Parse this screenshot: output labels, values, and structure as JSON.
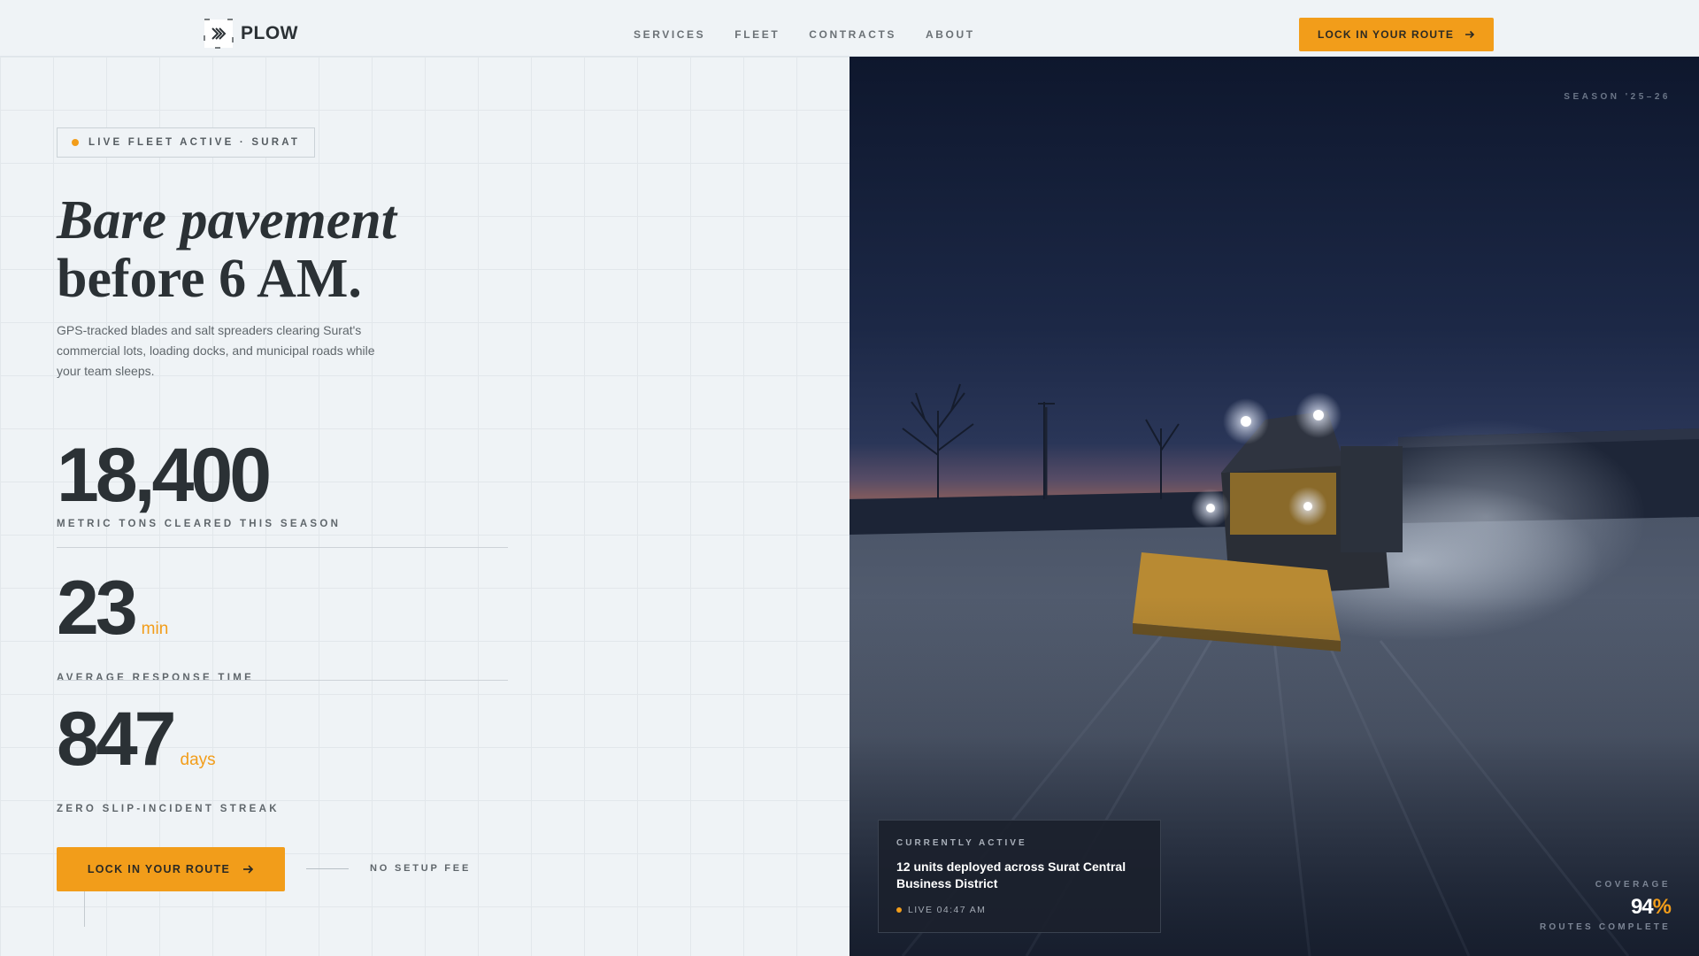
{
  "brand": {
    "name": "PLOW",
    "logo_icon": "chevron-logo-icon"
  },
  "nav": {
    "items": [
      {
        "label": "SERVICES"
      },
      {
        "label": "FLEET"
      },
      {
        "label": "CONTRACTS"
      },
      {
        "label": "ABOUT"
      }
    ],
    "cta_label": "LOCK IN YOUR ROUTE"
  },
  "hero": {
    "badge": "LIVE FLEET ACTIVE · SURAT",
    "headline_line1": "Bare pavement",
    "headline_line2": "before 6 AM.",
    "subcopy": "GPS-tracked blades and salt spreaders clearing Surat's commercial lots, loading docks, and municipal roads while your team sleeps."
  },
  "stats": [
    {
      "value": "18,400",
      "unit": "",
      "label": "METRIC TONS CLEARED THIS SEASON"
    },
    {
      "value": "23",
      "unit": "min",
      "label": "AVERAGE RESPONSE TIME"
    },
    {
      "value": "847",
      "unit": "days",
      "label": "ZERO SLIP-INCIDENT STREAK"
    }
  ],
  "cta": {
    "label": "LOCK IN YOUR ROUTE",
    "note": "NO SETUP FEE"
  },
  "image_panel": {
    "season": "SEASON '25–26",
    "active_card": {
      "kicker": "CURRENTLY ACTIVE",
      "title": "12 units deployed across Surat Central Business District",
      "status": "LIVE 04:47 AM"
    },
    "coverage": {
      "kicker": "COVERAGE",
      "value": "94",
      "percent_sign": "%",
      "sub": "ROUTES COMPLETE"
    }
  },
  "colors": {
    "accent": "#f29d1a",
    "ink": "#2b3135",
    "background": "#eff3f6",
    "night": "#0f1830"
  }
}
